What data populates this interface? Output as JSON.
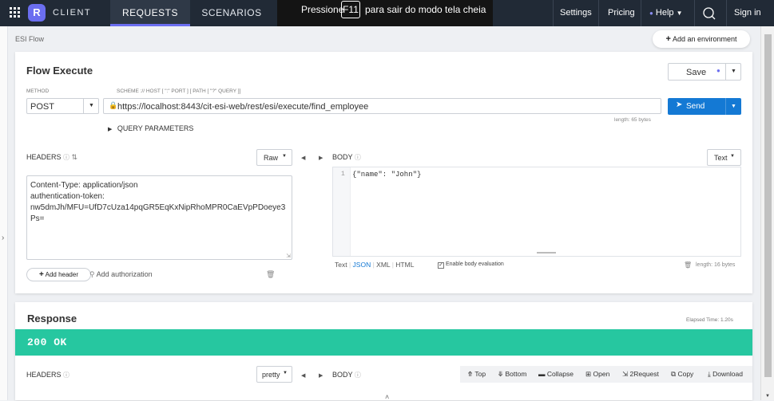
{
  "topbar": {
    "logo_letter": "R",
    "app_name": "CLIENT",
    "tabs": [
      {
        "label": "REQUESTS"
      },
      {
        "label": "SCENARIOS"
      }
    ],
    "fullscreen_notice": {
      "prefix": "Pressione",
      "key": "F11",
      "suffix": "para sair do modo tela cheia"
    },
    "links": {
      "settings": "Settings",
      "pricing": "Pricing",
      "help": "Help",
      "signin": "Sign in"
    }
  },
  "breadcrumb": "ESI Flow",
  "add_environment": "Add an environment",
  "request": {
    "title": "Flow Execute",
    "save_label": "Save",
    "method_label": "METHOD",
    "url_label": "SCHEME :// HOST [ \":\" PORT ] [ PATH [ \"?\" QUERY ]]",
    "method": "POST",
    "url": "https://localhost:8443/cit-esi-web/rest/esi/execute/find_employee",
    "length": "length: 65 bytes",
    "send_label": "Send",
    "query_params": "QUERY PARAMETERS",
    "headers_label": "HEADERS",
    "headers_mode": "Raw",
    "headers_text": [
      "Content-Type: application/json",
      "authentication-token:",
      "nw5dmJh/MFU=UfD7cUza14pqGR5EqKxNipRhoMPR0CaEVpPDoeye3",
      "Ps="
    ],
    "add_header": "Add header",
    "add_authorization": "Add authorization",
    "body_label": "BODY",
    "body_mode": "Text",
    "body_line_no": "1",
    "body_text": "{\"name\": \"John\"}",
    "body_formats": [
      "Text",
      "JSON",
      "XML",
      "HTML"
    ],
    "enable_eval": "Enable body evaluation",
    "body_length": "length: 16 bytes"
  },
  "response": {
    "title": "Response",
    "elapsed": "Elapsed Time: 1.20s",
    "status": "200 OK",
    "status_color": "#26c7a0",
    "headers_label": "HEADERS",
    "headers_mode": "pretty",
    "body_label": "BODY",
    "actions": [
      "Top",
      "Bottom",
      "Collapse",
      "Open",
      "2Request",
      "Copy",
      "Download"
    ]
  },
  "colors": {
    "accent": "#6b6ef0",
    "primary": "#1479d4",
    "topbar": "#212a36"
  }
}
